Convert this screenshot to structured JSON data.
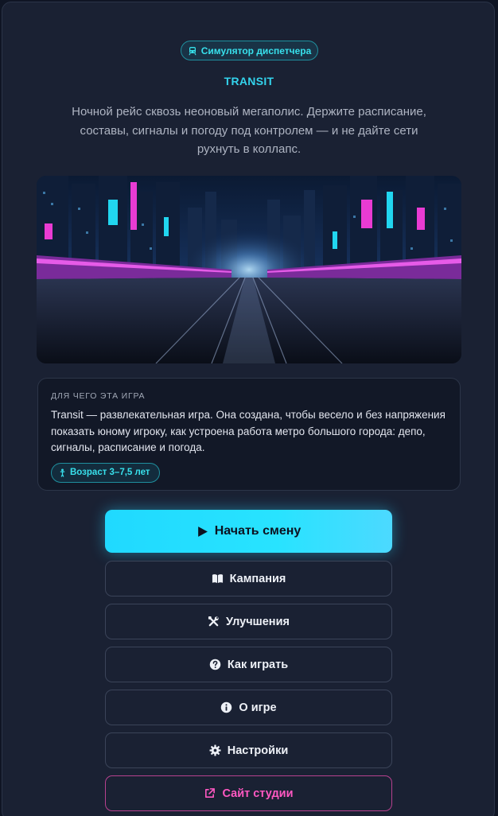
{
  "header": {
    "badge_label": "Симулятор диспетчера",
    "badge_icon": "train-icon",
    "title": "TRANSIT",
    "subtitle": "Ночной рейс сквозь неоновый мегаполис. Держите расписание, составы, сигналы и погоду под контролем — и не дайте сети рухнуть в коллапс."
  },
  "hero_image": {
    "description_icon": "neon-city-rail-illustration"
  },
  "info": {
    "heading": "ДЛЯ ЧЕГО ЭТА ИГРА",
    "text": "Transit — развлекательная игра. Она создана, чтобы весело и без напряжения показать юному игроку, как устроена работа метро большого города: депо, сигналы, расписание и погода.",
    "age_label": "Возраст 3–7,5 лет",
    "age_icon": "person-icon"
  },
  "menu": {
    "start": {
      "label": "Начать смену",
      "icon": "play-icon"
    },
    "campaign": {
      "label": "Кампания",
      "icon": "book-icon"
    },
    "upgrades": {
      "label": "Улучшения",
      "icon": "tools-icon"
    },
    "how_to_play": {
      "label": "Как играть",
      "icon": "question-circle-icon"
    },
    "about": {
      "label": "О игре",
      "icon": "info-circle-icon"
    },
    "settings": {
      "label": "Настройки",
      "icon": "gear-icon"
    },
    "studio": {
      "label": "Сайт студии",
      "icon": "external-link-icon"
    }
  },
  "colors": {
    "accent_cyan": "#28e3ff",
    "accent_pink": "#ff58c2",
    "panel_bg": "#1a2133",
    "page_bg": "#0f1524"
  }
}
